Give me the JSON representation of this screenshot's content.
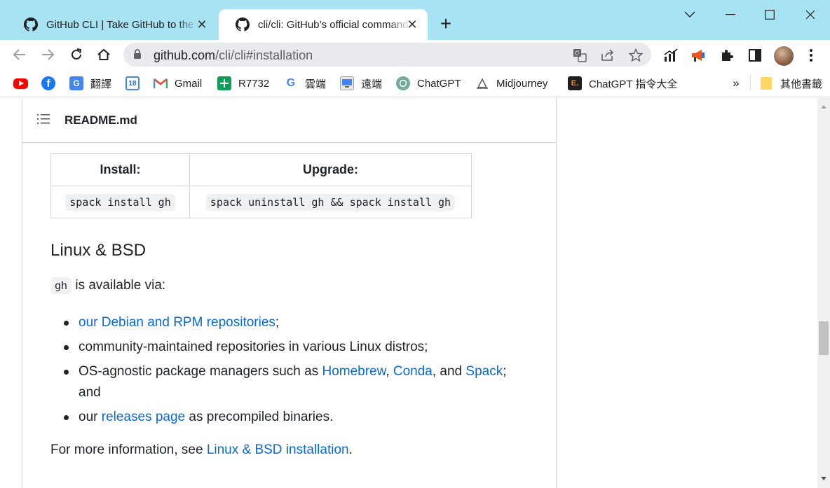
{
  "browser": {
    "tabs": [
      {
        "title": "GitHub CLI | Take GitHub to the command line",
        "active": false
      },
      {
        "title": "cli/cli: GitHub’s official command line tool",
        "active": true
      }
    ],
    "close_glyph": "✕",
    "new_tab_glyph": "+",
    "url_host": "github.com",
    "url_path": "/cli/cli#installation",
    "icons": [
      "back-icon",
      "forward-icon",
      "reload-icon",
      "home-icon",
      "lock-icon",
      "translate-icon",
      "share-icon",
      "star-icon",
      "extensions-icon",
      "sidepanel-icon",
      "menu-icon"
    ]
  },
  "bookmarks": {
    "items": [
      {
        "label": "",
        "icon": "youtube-icon",
        "color": "#ff0000"
      },
      {
        "label": "",
        "icon": "facebook-icon",
        "color": "#1877f2"
      },
      {
        "label": "翻譯",
        "icon": "google-translate-icon",
        "color": "#4285f4"
      },
      {
        "label": "",
        "icon": "calendar-icon",
        "color": "#4285f4"
      },
      {
        "label": "Gmail",
        "icon": "gmail-icon",
        "color": "#ea4335"
      },
      {
        "label": "R7732",
        "icon": "sheets-icon",
        "color": "#0f9d58"
      },
      {
        "label": "雲端",
        "icon": "google-icon",
        "color": "#4285f4"
      },
      {
        "label": "遠端",
        "icon": "remote-icon",
        "color": "#1a73e8"
      },
      {
        "label": "ChatGPT",
        "icon": "chatgpt-icon",
        "color": "#74aa9c"
      },
      {
        "label": "Midjourney",
        "icon": "midjourney-icon",
        "color": "#555555"
      },
      {
        "label": "ChatGPT 指令大全",
        "icon": "e-icon",
        "color": "#1f1f1f"
      }
    ],
    "overflow": "»",
    "other": "其他書籤"
  },
  "readme": {
    "filename": "README.md",
    "table": {
      "headers": [
        "Install:",
        "Upgrade:"
      ],
      "row": [
        "spack install gh",
        "spack uninstall gh && spack install gh"
      ]
    },
    "heading": "Linux & BSD",
    "intro_code": "gh",
    "intro_text": " is available via:",
    "bullets": {
      "b1_link": "our Debian and RPM repositories",
      "b1_tail": ";",
      "b2": "community-maintained repositories in various Linux distros;",
      "b3_pre": "OS-agnostic package managers such as ",
      "b3_l1": "Homebrew",
      "b3_sep1": ", ",
      "b3_l2": "Conda",
      "b3_sep2": ", and ",
      "b3_l3": "Spack",
      "b3_tail": "; and",
      "b4_pre": "our ",
      "b4_link": "releases page",
      "b4_tail": " as precompiled binaries."
    },
    "more_pre": "For more information, see ",
    "more_link": "Linux & BSD installation",
    "more_tail": "."
  },
  "colors": {
    "tabstrip": "#a7e3f3",
    "link": "#0969da",
    "text": "#1f2328"
  }
}
